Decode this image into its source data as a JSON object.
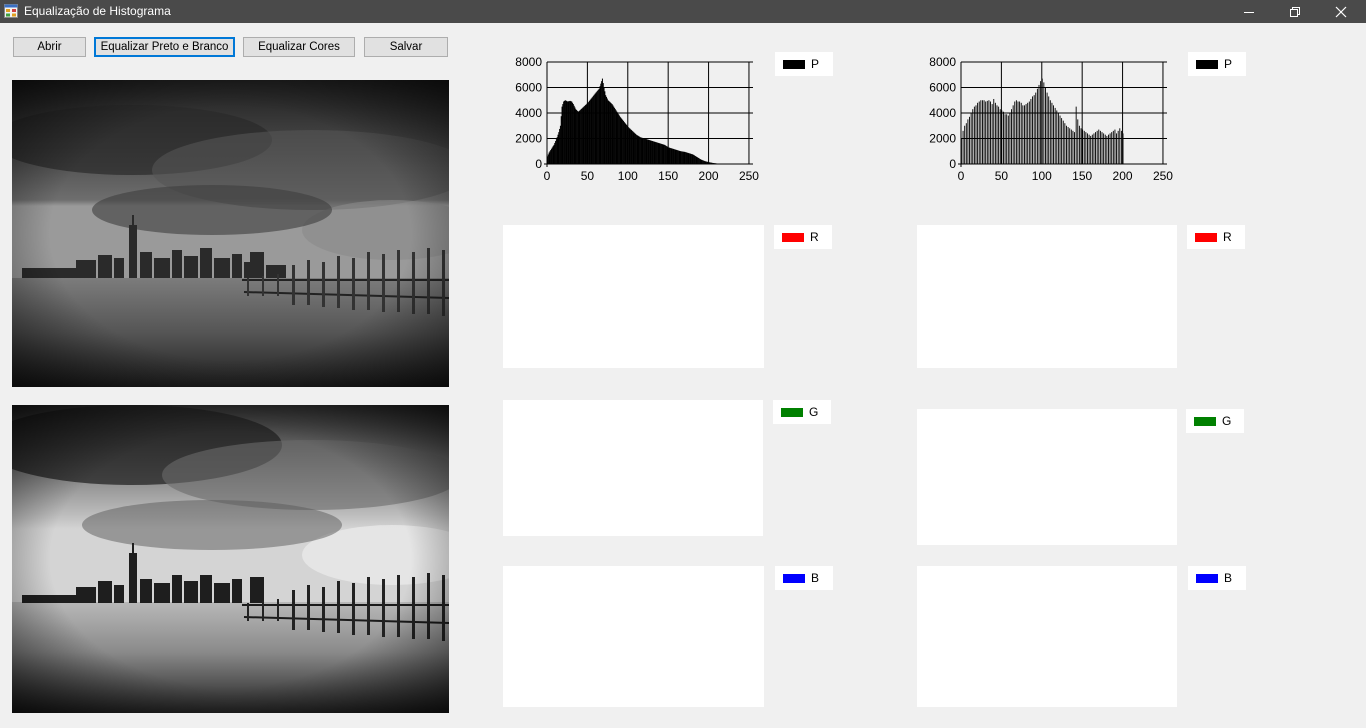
{
  "window": {
    "title": "Equalização de Histograma",
    "icon": "app-form-icon",
    "controls": [
      "minimize-icon",
      "restore-icon",
      "close-icon"
    ]
  },
  "toolbar": {
    "open_label": "Abrir",
    "equalize_bw_label": "Equalizar Preto e Branco",
    "equalize_color_label": "Equalizar Cores",
    "save_label": "Salvar"
  },
  "images": {
    "original": "city-skyline-pier-grayscale-original",
    "equalized": "city-skyline-pier-grayscale-equalized"
  },
  "legends": {
    "p": "P",
    "r": "R",
    "g": "G",
    "b": "B",
    "colors": {
      "p": "#000000",
      "r": "#ff0000",
      "g": "#008000",
      "b": "#0000ff"
    }
  },
  "chart_data": [
    {
      "type": "bar",
      "series_label": "P",
      "x_ticks": [
        "0",
        "50",
        "100",
        "150",
        "200",
        "250"
      ],
      "y_ticks": [
        "0",
        "2000",
        "4000",
        "6000",
        "8000"
      ],
      "xlim": [
        0,
        255
      ],
      "ylim": [
        0,
        8000
      ],
      "grid": true,
      "legend": "right",
      "points": [
        [
          0,
          600
        ],
        [
          2,
          900
        ],
        [
          5,
          1200
        ],
        [
          8,
          1500
        ],
        [
          10,
          1800
        ],
        [
          12,
          2100
        ],
        [
          14,
          2500
        ],
        [
          16,
          3000
        ],
        [
          18,
          4500
        ],
        [
          20,
          4900
        ],
        [
          22,
          5000
        ],
        [
          25,
          4900
        ],
        [
          28,
          4950
        ],
        [
          30,
          4900
        ],
        [
          32,
          4700
        ],
        [
          35,
          4300
        ],
        [
          38,
          4100
        ],
        [
          40,
          4200
        ],
        [
          45,
          4500
        ],
        [
          50,
          4800
        ],
        [
          55,
          5200
        ],
        [
          60,
          5600
        ],
        [
          64,
          5900
        ],
        [
          66,
          6300
        ],
        [
          68,
          6700
        ],
        [
          70,
          6000
        ],
        [
          72,
          5400
        ],
        [
          75,
          5000
        ],
        [
          80,
          4700
        ],
        [
          85,
          4200
        ],
        [
          90,
          3700
        ],
        [
          95,
          3300
        ],
        [
          100,
          2900
        ],
        [
          105,
          2600
        ],
        [
          110,
          2300
        ],
        [
          115,
          2100
        ],
        [
          120,
          2000
        ],
        [
          125,
          1900
        ],
        [
          130,
          1800
        ],
        [
          135,
          1700
        ],
        [
          140,
          1600
        ],
        [
          145,
          1500
        ],
        [
          150,
          1300
        ],
        [
          155,
          1200
        ],
        [
          160,
          1100
        ],
        [
          165,
          1000
        ],
        [
          170,
          950
        ],
        [
          175,
          850
        ],
        [
          180,
          750
        ],
        [
          185,
          550
        ],
        [
          190,
          350
        ],
        [
          195,
          220
        ],
        [
          200,
          140
        ],
        [
          205,
          80
        ],
        [
          210,
          40
        ],
        [
          215,
          15
        ],
        [
          220,
          5
        ]
      ]
    },
    {
      "type": "bar",
      "series_label": "P",
      "x_ticks": [
        "0",
        "50",
        "100",
        "150",
        "200",
        "250"
      ],
      "y_ticks": [
        "0",
        "2000",
        "4000",
        "6000",
        "8000"
      ],
      "xlim": [
        0,
        255
      ],
      "ylim": [
        0,
        8000
      ],
      "grid": true,
      "legend": "right",
      "points": [
        [
          0,
          2000
        ],
        [
          2,
          2600
        ],
        [
          4,
          3000
        ],
        [
          6,
          3200
        ],
        [
          8,
          3500
        ],
        [
          10,
          3700
        ],
        [
          12,
          4000
        ],
        [
          14,
          4300
        ],
        [
          16,
          4500
        ],
        [
          18,
          4600
        ],
        [
          20,
          4800
        ],
        [
          22,
          4900
        ],
        [
          24,
          5000
        ],
        [
          26,
          5000
        ],
        [
          28,
          5000
        ],
        [
          30,
          4900
        ],
        [
          32,
          4950
        ],
        [
          34,
          5000
        ],
        [
          36,
          4900
        ],
        [
          38,
          4700
        ],
        [
          40,
          5100
        ],
        [
          42,
          4800
        ],
        [
          44,
          4600
        ],
        [
          46,
          4500
        ],
        [
          48,
          4300
        ],
        [
          50,
          4200
        ],
        [
          52,
          4100
        ],
        [
          54,
          3900
        ],
        [
          56,
          3900
        ],
        [
          58,
          3800
        ],
        [
          60,
          4000
        ],
        [
          62,
          4300
        ],
        [
          64,
          4600
        ],
        [
          66,
          4900
        ],
        [
          68,
          5000
        ],
        [
          70,
          4900
        ],
        [
          72,
          4900
        ],
        [
          74,
          4800
        ],
        [
          76,
          4600
        ],
        [
          78,
          4600
        ],
        [
          80,
          4700
        ],
        [
          82,
          4800
        ],
        [
          84,
          4900
        ],
        [
          86,
          5100
        ],
        [
          88,
          5300
        ],
        [
          90,
          5400
        ],
        [
          92,
          5600
        ],
        [
          94,
          5900
        ],
        [
          96,
          6200
        ],
        [
          98,
          6500
        ],
        [
          100,
          6700
        ],
        [
          102,
          6400
        ],
        [
          104,
          6000
        ],
        [
          106,
          5600
        ],
        [
          108,
          5300
        ],
        [
          110,
          5000
        ],
        [
          112,
          4800
        ],
        [
          114,
          4600
        ],
        [
          116,
          4400
        ],
        [
          118,
          4200
        ],
        [
          120,
          4000
        ],
        [
          122,
          3800
        ],
        [
          124,
          3600
        ],
        [
          126,
          3400
        ],
        [
          128,
          3200
        ],
        [
          130,
          3000
        ],
        [
          132,
          2900
        ],
        [
          134,
          2800
        ],
        [
          136,
          2700
        ],
        [
          138,
          2600
        ],
        [
          140,
          2500
        ],
        [
          142,
          4500
        ],
        [
          144,
          3500
        ],
        [
          146,
          3000
        ],
        [
          148,
          2800
        ],
        [
          150,
          2700
        ],
        [
          152,
          2600
        ],
        [
          154,
          2500
        ],
        [
          156,
          2400
        ],
        [
          158,
          2300
        ],
        [
          160,
          2200
        ],
        [
          162,
          2300
        ],
        [
          164,
          2400
        ],
        [
          166,
          2500
        ],
        [
          168,
          2600
        ],
        [
          170,
          2700
        ],
        [
          172,
          2600
        ],
        [
          174,
          2500
        ],
        [
          176,
          2400
        ],
        [
          178,
          2300
        ],
        [
          180,
          2200
        ],
        [
          182,
          2300
        ],
        [
          184,
          2400
        ],
        [
          186,
          2500
        ],
        [
          188,
          2600
        ],
        [
          190,
          2700
        ],
        [
          192,
          2400
        ],
        [
          194,
          2600
        ],
        [
          196,
          2800
        ],
        [
          198,
          2600
        ],
        [
          200,
          2400
        ]
      ]
    }
  ]
}
